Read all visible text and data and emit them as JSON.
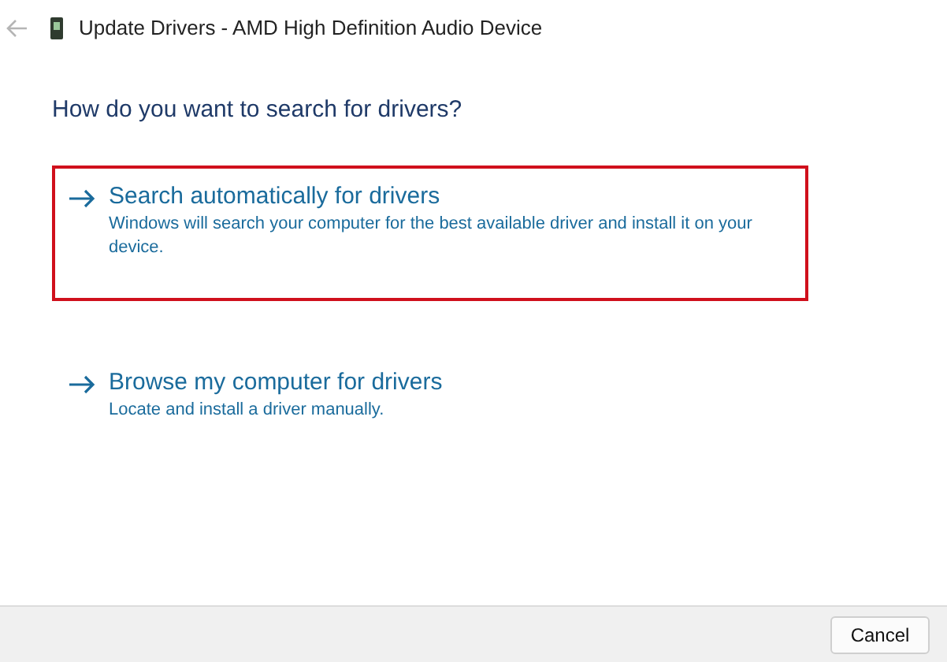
{
  "window": {
    "title": "Update Drivers - AMD High Definition Audio Device"
  },
  "heading": "How do you want to search for drivers?",
  "options": [
    {
      "title": "Search automatically for drivers",
      "description": "Windows will search your computer for the best available driver and install it on your device.",
      "highlighted": true
    },
    {
      "title": "Browse my computer for drivers",
      "description": "Locate and install a driver manually.",
      "highlighted": false
    }
  ],
  "buttons": [
    "Cancel"
  ]
}
